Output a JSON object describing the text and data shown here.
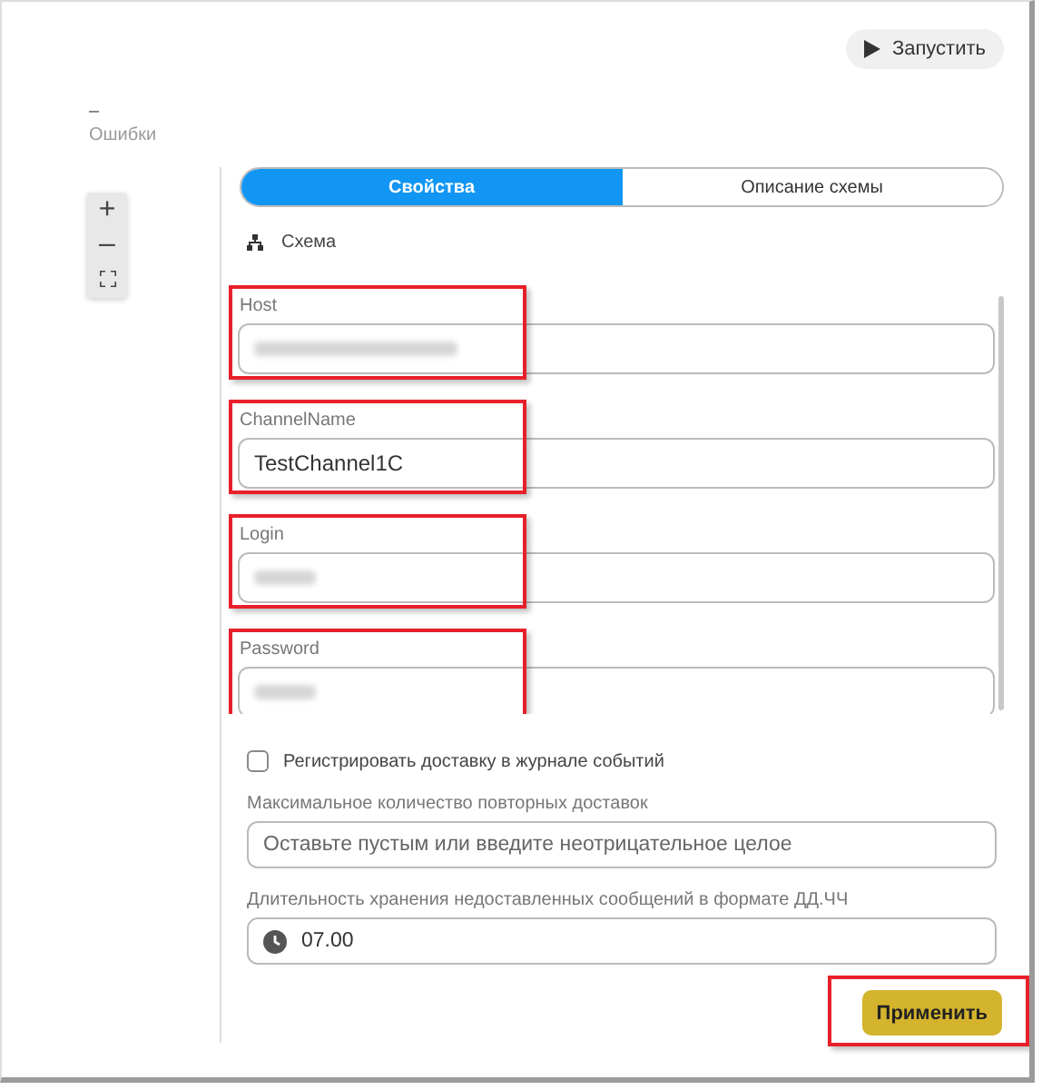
{
  "toolbar": {
    "run_button": "Запустить"
  },
  "status": {
    "value": "–",
    "label": "Ошибки"
  },
  "zoom_controls": [
    "+",
    "–"
  ],
  "tabs": [
    {
      "label": "Свойства",
      "selected": true
    },
    {
      "label": "Описание схемы",
      "selected": false
    }
  ],
  "breadcrumb": "Схема",
  "fields": [
    {
      "label": "Host",
      "redacted": true,
      "highlighted": true
    },
    {
      "label": "ChannelName",
      "value": "TestChannel1C",
      "highlighted": true
    },
    {
      "label": "Login",
      "redacted": true,
      "highlighted": true
    },
    {
      "label": "Password",
      "redacted": true,
      "highlighted": true
    }
  ],
  "log_delivery": {
    "label": "Регистрировать доставку в журнале событий",
    "checked": false
  },
  "max_retries": {
    "label": "Максимальное количество повторных доставок",
    "placeholder": "Оставьте пустым или введите неотрицательное целое"
  },
  "retention": {
    "label": "Длительность хранения недоставленных сообщений в формате ДД.ЧЧ",
    "value": "07.00"
  },
  "apply_button": {
    "label": "Применить",
    "highlighted": true
  }
}
